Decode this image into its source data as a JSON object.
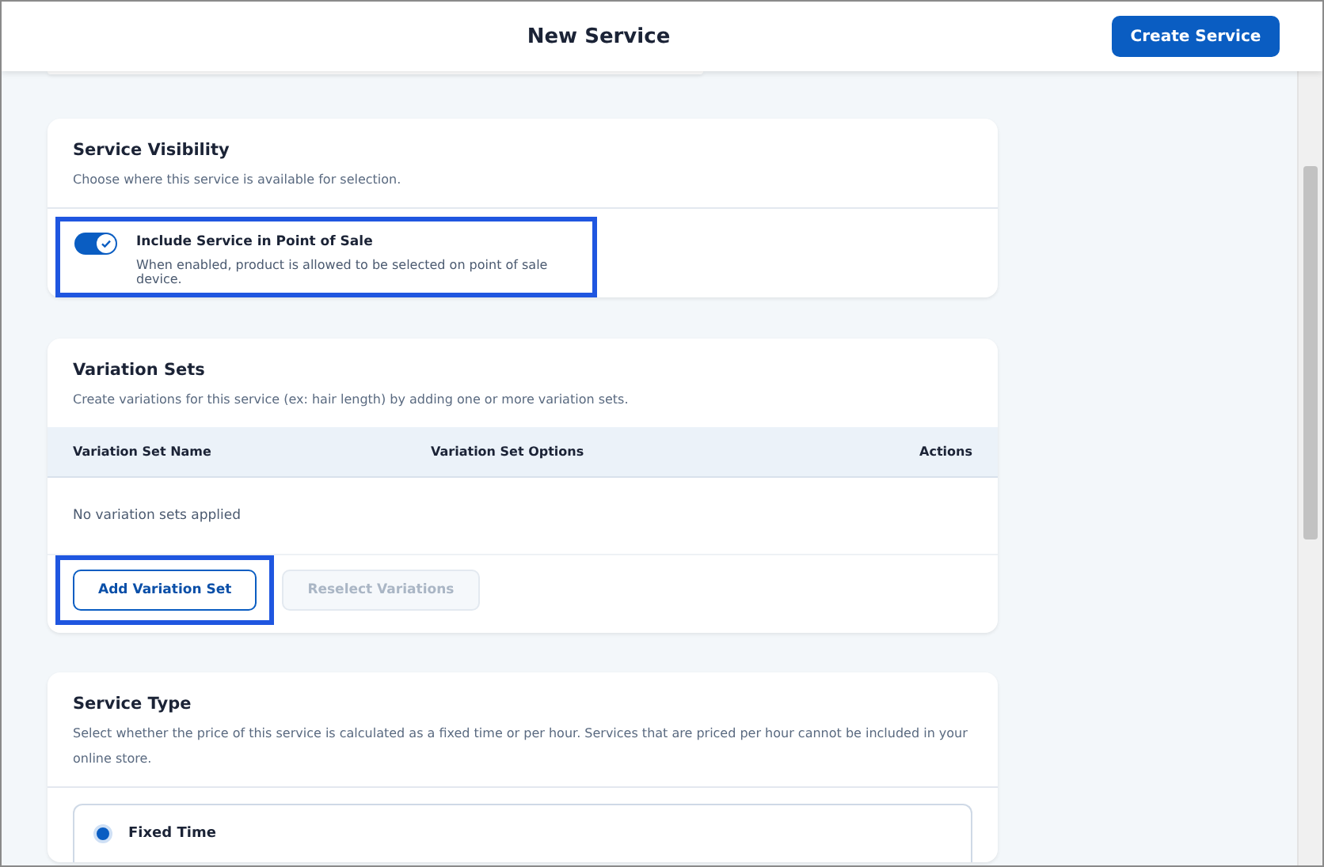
{
  "header": {
    "title": "New Service",
    "primary_button": "Create Service"
  },
  "visibility": {
    "title": "Service Visibility",
    "description": "Choose where this service is available for selection.",
    "toggle": {
      "label": "Include Service in Point of Sale",
      "hint": "When enabled, product is allowed to be selected on point of sale device.",
      "on": true,
      "highlighted": true
    }
  },
  "variation_sets": {
    "title": "Variation Sets",
    "description": "Create variations for this service (ex: hair length) by adding one or more variation sets.",
    "table": {
      "columns": [
        "Variation Set Name",
        "Variation Set Options",
        "Actions"
      ],
      "empty_message": "No variation sets applied"
    },
    "buttons": [
      {
        "label": "Add Variation Set",
        "disabled": false,
        "highlighted": true
      },
      {
        "label": "Reselect Variations",
        "disabled": true,
        "highlighted": false
      }
    ]
  },
  "service_type": {
    "title": "Service Type",
    "description": "Select whether the price of this service is calculated as a fixed time or per hour. Services that are priced per hour cannot be included in your online store.",
    "options": [
      {
        "label": "Fixed Time",
        "selected": true
      }
    ]
  }
}
